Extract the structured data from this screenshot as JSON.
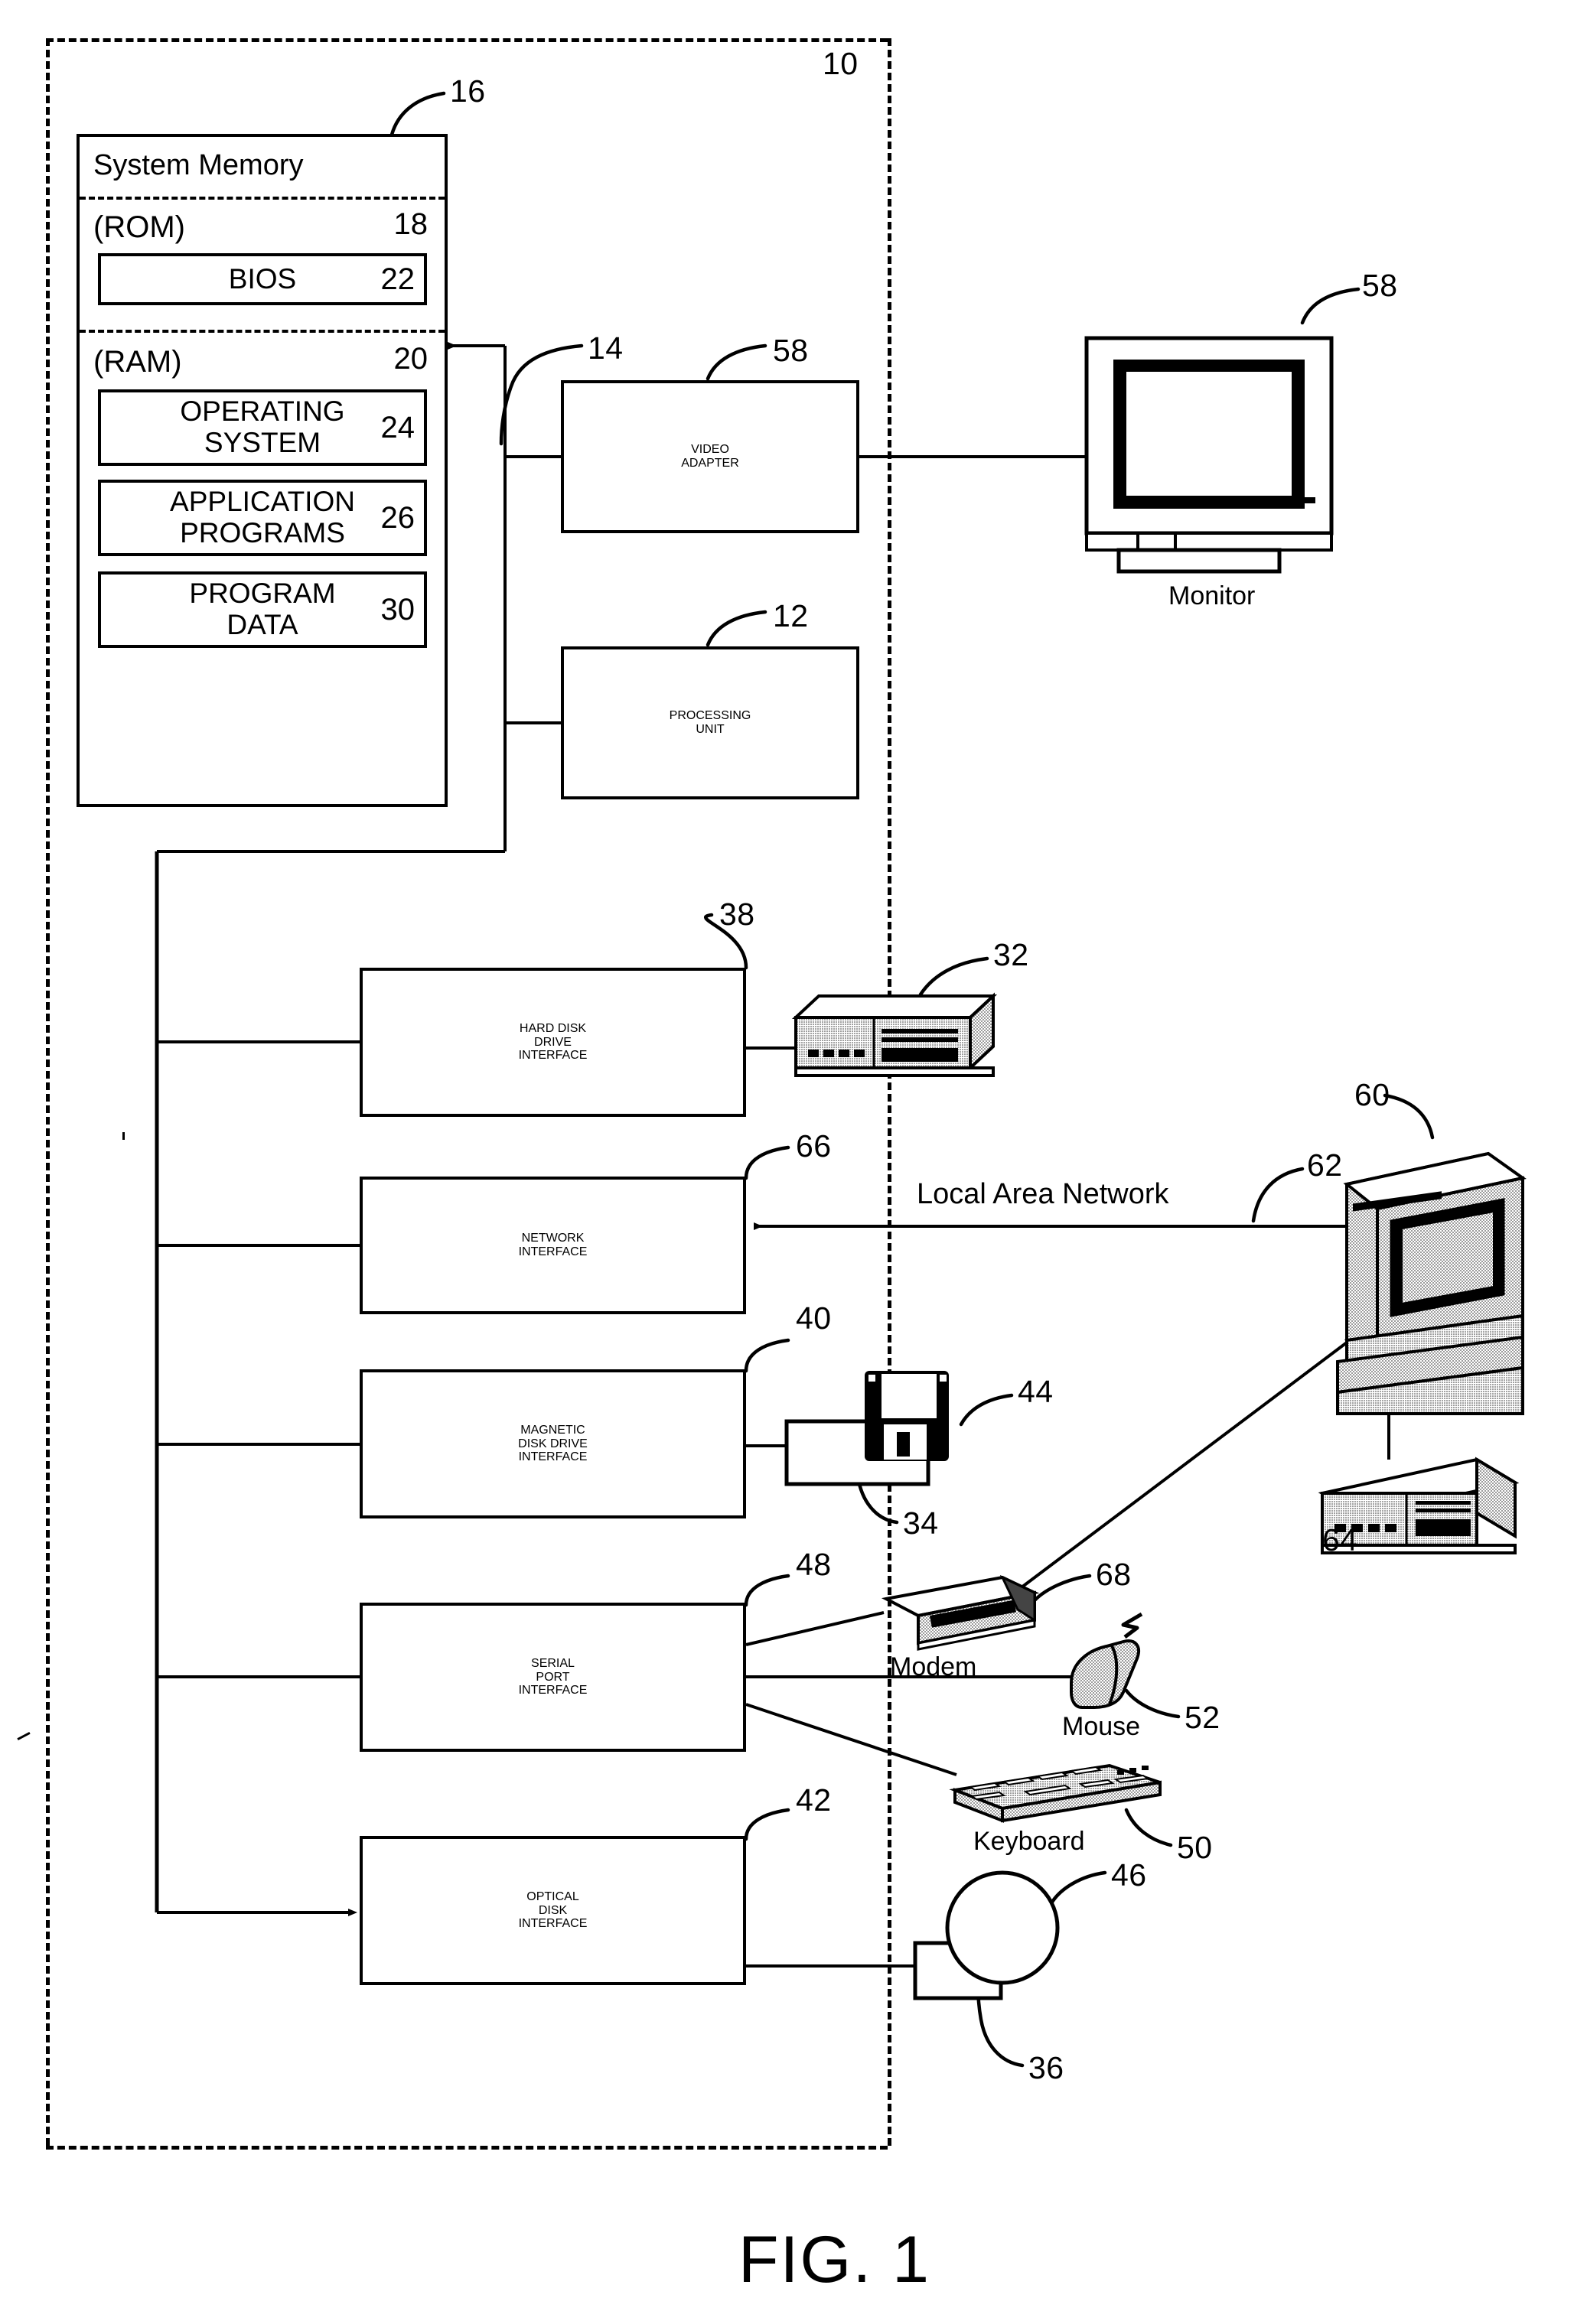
{
  "figure": {
    "caption": "FIG. 1",
    "system_ref": "10",
    "bus_ref": "14"
  },
  "system_memory": {
    "title": "System Memory",
    "ref": "16",
    "rom_label": "(ROM)",
    "rom_ref": "18",
    "bios_label": "BIOS",
    "bios_ref": "22",
    "ram_label": "(RAM)",
    "ram_ref": "20",
    "blocks": [
      {
        "label": "OPERATING\nSYSTEM",
        "line1": "OPERATING",
        "line2": "SYSTEM",
        "ref": "24"
      },
      {
        "label": "APPLICATION\nPROGRAMS",
        "line1": "APPLICATION",
        "line2": "PROGRAMS",
        "ref": "26"
      },
      {
        "label": "PROGRAM\nDATA",
        "line1": "PROGRAM",
        "line2": "DATA",
        "ref": "30"
      }
    ]
  },
  "blocks": {
    "video_adapter": {
      "line1": "VIDEO",
      "line2": "ADAPTER",
      "ref": "58"
    },
    "processing_unit": {
      "line1": "PROCESSING",
      "line2": "UNIT",
      "ref": "12"
    },
    "hard_disk_interface": {
      "line1": "HARD DISK",
      "line2": "DRIVE",
      "line3": "INTERFACE",
      "ref": "38"
    },
    "network_interface": {
      "line1": "NETWORK",
      "line2": "INTERFACE",
      "ref": "66"
    },
    "magnetic_disk_interface": {
      "line1": "MAGNETIC",
      "line2": "DISK DRIVE",
      "line3": "INTERFACE",
      "ref": "40"
    },
    "serial_port_interface": {
      "line1": "SERIAL",
      "line2": "PORT",
      "line3": "INTERFACE",
      "ref": "48"
    },
    "optical_disk_interface": {
      "line1": "OPTICAL",
      "line2": "DISK",
      "line3": "INTERFACE",
      "ref": "42"
    }
  },
  "devices": {
    "monitor": {
      "label": "Monitor",
      "ref": "58"
    },
    "hard_disk_drive": {
      "ref": "32"
    },
    "floppy_disk": {
      "ref": "44"
    },
    "floppy_drive": {
      "ref": "34"
    },
    "modem": {
      "label": "Modem",
      "ref": "68"
    },
    "mouse": {
      "label": "Mouse",
      "ref": "52"
    },
    "keyboard": {
      "label": "Keyboard",
      "ref": "50"
    },
    "optical_disk": {
      "ref": "46"
    },
    "optical_drive": {
      "ref": "36"
    },
    "remote_computer": {
      "ref": "60"
    },
    "remote_drive": {
      "ref": "64"
    }
  },
  "network": {
    "label": "Local Area Network",
    "ref": "62"
  }
}
